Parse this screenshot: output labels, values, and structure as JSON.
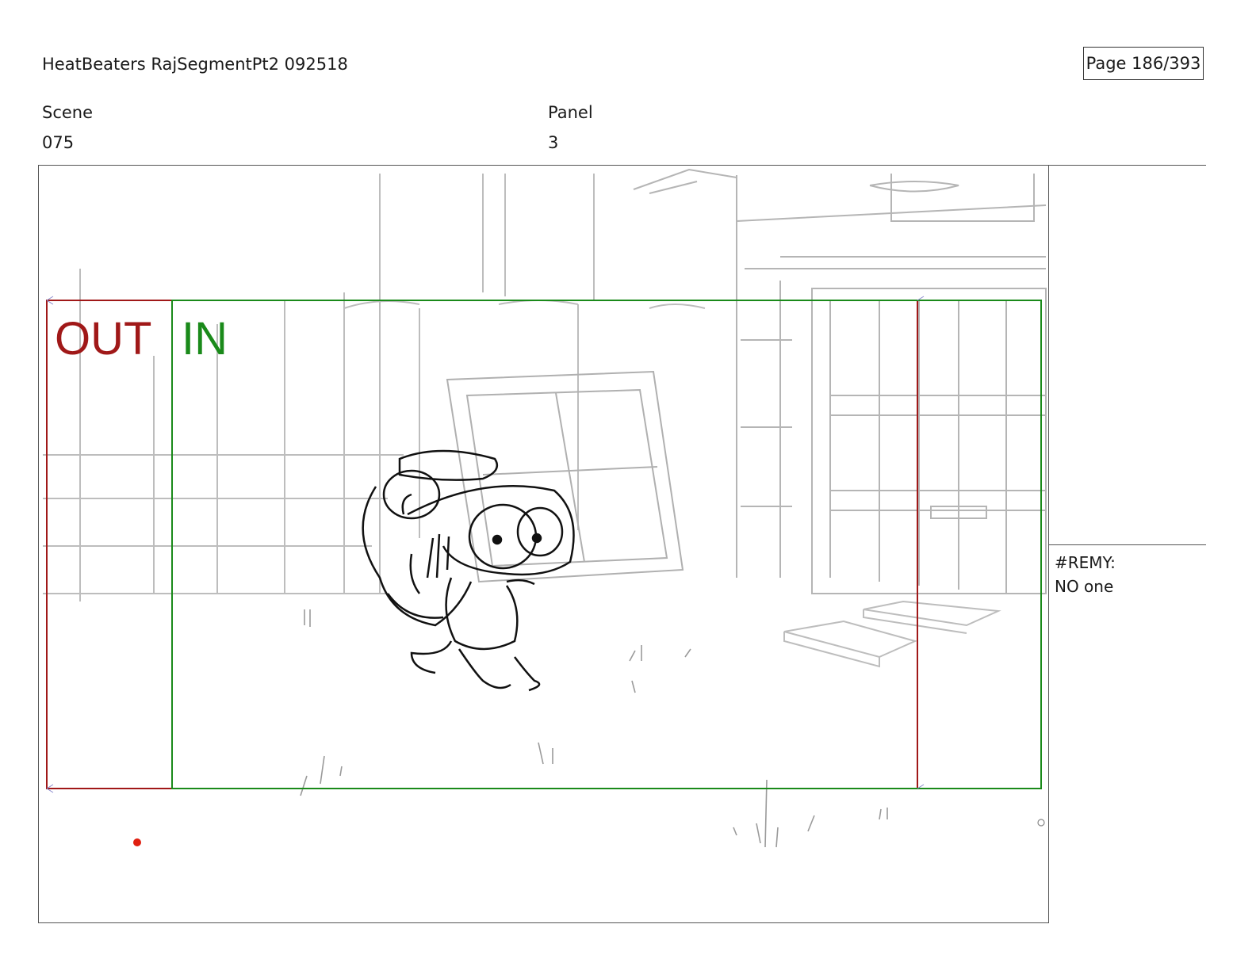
{
  "header": {
    "title": "HeatBeaters RajSegmentPt2 092518",
    "page": "Page 186/393"
  },
  "meta": {
    "scene_label": "Scene",
    "scene_value": "075",
    "panel_label": "Panel",
    "panel_value": "3"
  },
  "panel": {
    "out_label": "OUT",
    "in_label": "IN",
    "colors": {
      "out": "#a01818",
      "in": "#1a8a1a",
      "dot": "#e02010"
    }
  },
  "notes": {
    "speaker": "#REMY:",
    "line": "NO one"
  }
}
